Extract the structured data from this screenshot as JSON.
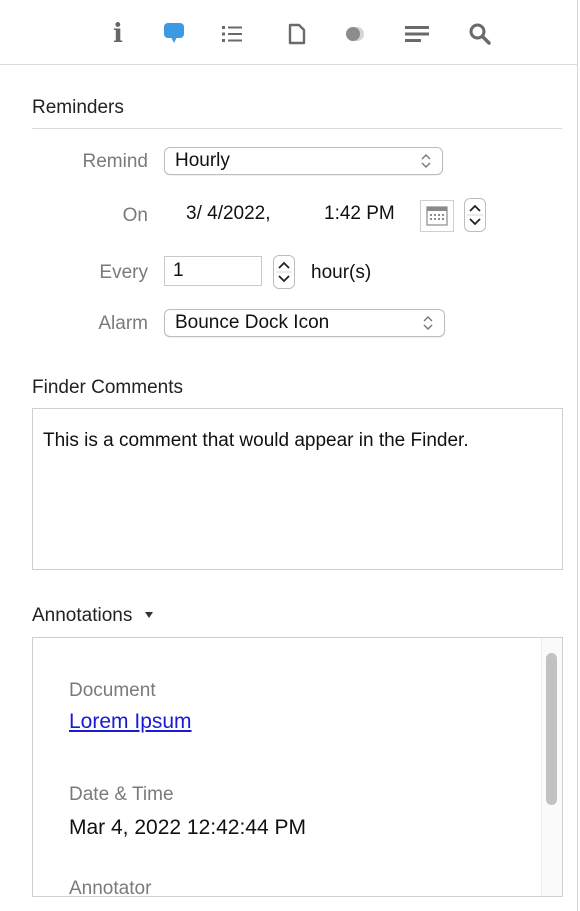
{
  "toolbar": {
    "icons": [
      "info-icon",
      "comment-icon",
      "list-icon",
      "document-icon",
      "circles-icon",
      "lines-icon",
      "search-icon"
    ],
    "info_glyph": "i",
    "accent_color": "#3b9ae1"
  },
  "reminders": {
    "title": "Reminders",
    "remind_label": "Remind",
    "remind_value": "Hourly",
    "on_label": "On",
    "on_date": "3/ 4/2022,",
    "on_time": "1:42 PM",
    "every_label": "Every",
    "every_value": "1",
    "every_unit": "hour(s)",
    "alarm_label": "Alarm",
    "alarm_value": "Bounce Dock Icon"
  },
  "comments": {
    "title": "Finder Comments",
    "text": "This is a comment that would appear in the Finder."
  },
  "annotations": {
    "title": "Annotations",
    "document_label": "Document",
    "document_value": "Lorem Ipsum",
    "datetime_label": "Date & Time",
    "datetime_value": "Mar 4, 2022 12:42:44 PM",
    "annotator_label": "Annotator"
  }
}
